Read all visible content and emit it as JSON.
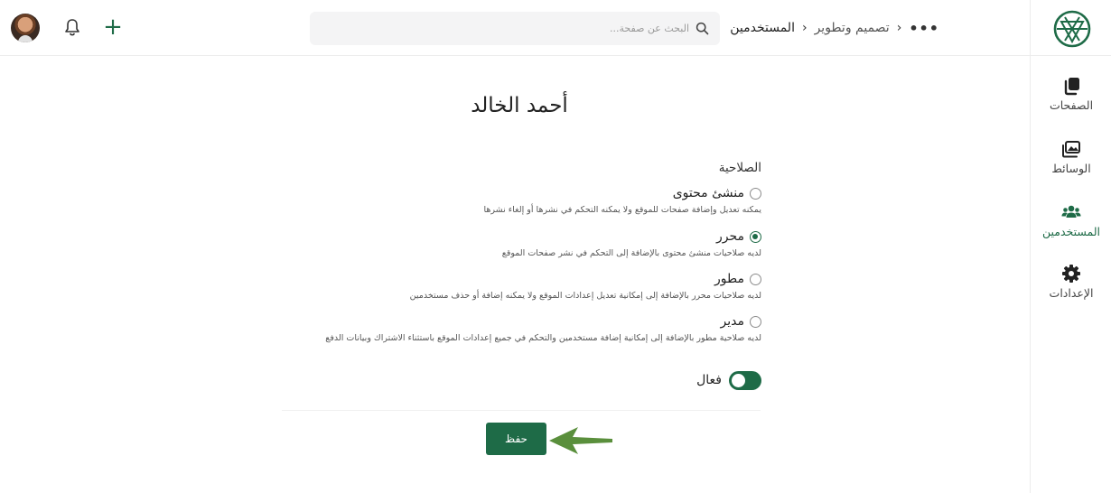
{
  "header": {
    "search_placeholder": "البحث عن صفحة...",
    "breadcrumb": [
      {
        "label": "تصميم وتطوير"
      },
      {
        "label": "المستخدمين"
      }
    ],
    "breadcrumb_separator": "‹",
    "more_label": "•••",
    "add_label": "+"
  },
  "sidebar": {
    "items": [
      {
        "label": "الصفحات",
        "icon": "pages-icon",
        "active": false
      },
      {
        "label": "الوسائط",
        "icon": "media-icon",
        "active": false
      },
      {
        "label": "المستخدمين",
        "icon": "users-icon",
        "active": true
      },
      {
        "label": "الإعدادات",
        "icon": "gear-icon",
        "active": false
      }
    ]
  },
  "main": {
    "user_name": "أحمد الخالد",
    "permission_label": "الصلاحية",
    "roles": [
      {
        "name": "منشئ محتوى",
        "description": "يمكنه تعديل وإضافة صفحات للموقع ولا يمكنه التحكم في نشرها أو إلغاء نشرها",
        "selected": false
      },
      {
        "name": "محرر",
        "description": "لديه صلاحيات منشئ محتوى بالإضافة إلى التحكم في نشر صفحات الموقع",
        "selected": true
      },
      {
        "name": "مطور",
        "description": "لديه صلاحيات محرر بالإضافة إلى إمكانية تعديل إعدادات الموقع ولا يمكنه إضافة أو حذف مستخدمين",
        "selected": false
      },
      {
        "name": "مدير",
        "description": "لديه صلاحية مطور بالإضافة إلى إمكانية إضافة مستخدمين والتحكم في جميع إعدادات الموقع باستثناء الاشتراك وبيانات الدفع",
        "selected": false
      }
    ],
    "active_label": "فعال",
    "active_on": true,
    "save_label": "حفظ"
  },
  "colors": {
    "accent": "#1e6b47",
    "arrow": "#5a8f3c"
  }
}
